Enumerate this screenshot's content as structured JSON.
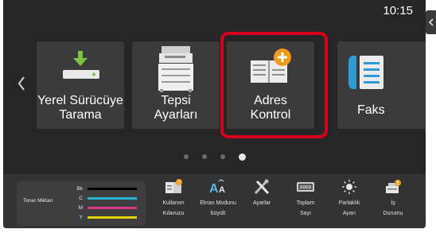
{
  "status": {
    "time": "10:15"
  },
  "tiles": [
    {
      "label_line1": "Yerel Sürücüye",
      "label_line2": "Tarama",
      "icon": "download-to-drive-icon"
    },
    {
      "label_line1": "Tepsi",
      "label_line2": "Ayarları",
      "icon": "printer-icon"
    },
    {
      "label_line1": "Adres",
      "label_line2": "Kontrol",
      "icon": "address-book-add-icon"
    },
    {
      "label_line1": "Faks",
      "label_line2": "",
      "icon": "fax-icon"
    }
  ],
  "pager": {
    "page_count": 4,
    "active_index": 3
  },
  "toner": {
    "title": "Toner Miktarı",
    "channels": [
      {
        "letter": "Bk",
        "color": "#000000",
        "level": 1.0
      },
      {
        "letter": "C",
        "color": "#2ab7d4",
        "level": 1.0
      },
      {
        "letter": "M",
        "color": "#d63b8f",
        "level": 1.0
      },
      {
        "letter": "Y",
        "color": "#e3d400",
        "level": 1.0
      }
    ]
  },
  "functions": [
    {
      "line1": "Kullanım",
      "line2": "Kılavuzu",
      "icon": "user-guide-icon"
    },
    {
      "line1": "Ekran Modunu",
      "line2": "büyült",
      "icon": "enlarge-text-icon"
    },
    {
      "line1": "Ayarlar",
      "line2": "",
      "icon": "settings-tools-icon"
    },
    {
      "line1": "Toplam",
      "line2": "Sayı",
      "icon": "counter-icon"
    },
    {
      "line1": "Parlaklık",
      "line2": "Ayarı",
      "icon": "brightness-icon"
    },
    {
      "line1": "İş",
      "line2": "Durumu",
      "icon": "job-status-icon"
    }
  ],
  "colors": {
    "highlight": "#d8001c",
    "accent_green": "#7dc242",
    "accent_orange": "#f29a1e",
    "accent_blue": "#2f9ad6"
  }
}
